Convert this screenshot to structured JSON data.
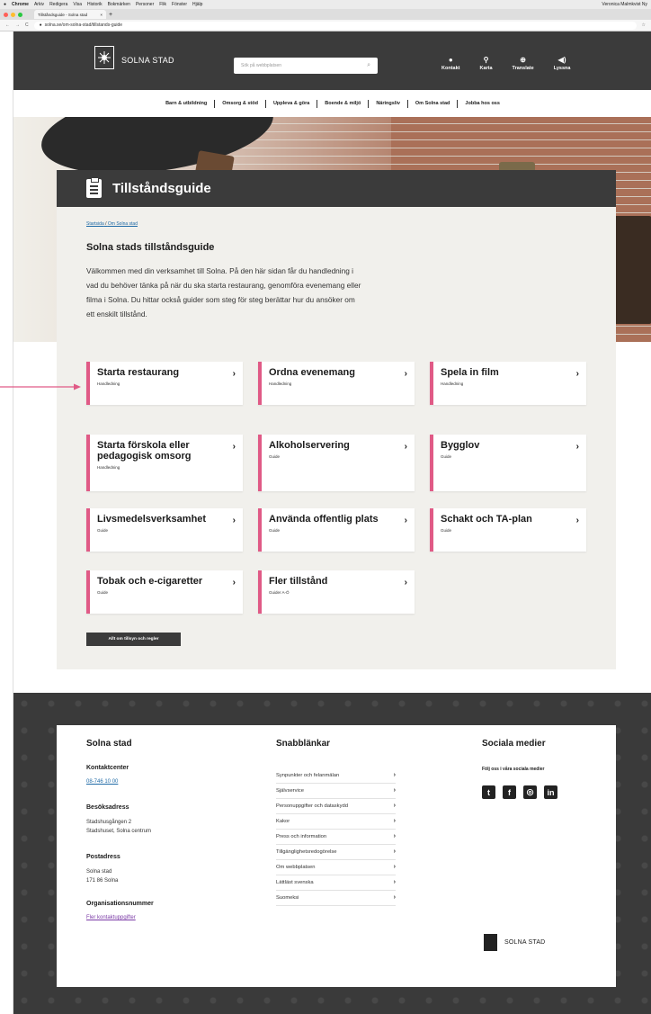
{
  "menubar": {
    "app": "Chrome",
    "items": [
      "Arkiv",
      "Redigera",
      "Visa",
      "Historik",
      "Bokmärken",
      "Personer",
      "Flik",
      "Fönster",
      "Hjälp"
    ],
    "right": "Veronica Malmkvist Ny"
  },
  "browser": {
    "tab_title": "Tillståndsguide - Solna stad",
    "url": "solna.se/om-solna-stad/tillstands-guide",
    "url_domain": "solna.se"
  },
  "header": {
    "logo_text": "SOLNA STAD",
    "search_placeholder": "Sök på webbplatsen",
    "icons": [
      {
        "label": "Kontakt",
        "icon": "chat-icon"
      },
      {
        "label": "Karta",
        "icon": "map-pin-icon"
      },
      {
        "label": "Translate",
        "icon": "globe-icon"
      },
      {
        "label": "Lyssna",
        "icon": "speaker-icon"
      }
    ]
  },
  "nav": [
    "Barn & utbildning",
    "Omsorg & stöd",
    "Uppleva & göra",
    "Boende & miljö",
    "Näringsliv",
    "Om Solna stad",
    "Jobba hos oss"
  ],
  "page": {
    "title": "Tillståndsguide",
    "breadcrumb": [
      "Startsida",
      "Om Solna stad"
    ],
    "heading": "Solna stads tillståndsguide",
    "intro": "Välkommen med din verksamhet till Solna. På den här sidan får du handledning i vad du behöver tänka på när du ska starta restaurang, genomföra evenemang eller filma i Solna. Du hittar också guider som steg för steg berättar hur du ansöker om ett enskilt tillstånd.",
    "all_button": "Allt om tillsyn och regler"
  },
  "tiles": [
    {
      "title": "Starta restaurang",
      "sub": "Handledning"
    },
    {
      "title": "Ordna evenemang",
      "sub": "Handledning"
    },
    {
      "title": "Spela in film",
      "sub": "Handledning"
    },
    {
      "title": "Starta förskola eller pedagogisk omsorg",
      "sub": "Handledning"
    },
    {
      "title": "Alkoholservering",
      "sub": "Guide"
    },
    {
      "title": "Bygglov",
      "sub": "Guide"
    },
    {
      "title": "Livsmedelsverksamhet",
      "sub": "Guide"
    },
    {
      "title": "Använda offentlig plats",
      "sub": "Guide"
    },
    {
      "title": "Schakt och TA-plan",
      "sub": "Guide"
    },
    {
      "title": "Tobak och e-cigaretter",
      "sub": "Guide"
    },
    {
      "title": "Fler tillstånd",
      "sub": "Guider A-Ö"
    }
  ],
  "footer": {
    "org": "Solna stad",
    "contact_label": "Kontaktcenter",
    "phone": "08-746 10 00",
    "visit_label": "Besöksadress",
    "visit": [
      "Stadshusgången 2",
      "Stadshuset, Solna centrum"
    ],
    "post_label": "Postadress",
    "post": [
      "Solna stad",
      "171 86 Solna"
    ],
    "orgnr_label": "Organisationsnummer",
    "more_link": "Fler kontaktuppgifter",
    "quick_title": "Snabblänkar",
    "quick": [
      "Synpunkter och felanmälan",
      "Självservice",
      "Personuppgifter och dataskydd",
      "Kakor",
      "Press och information",
      "Tillgänglighetsredogörelse",
      "Om webbplatsen",
      "Lättläst svenska",
      "Suomeksi"
    ],
    "social_title": "Sociala medier",
    "social_sub": "Följ oss i våra sociala medier",
    "social_icons": [
      "twitter-icon",
      "facebook-icon",
      "instagram-icon",
      "linkedin-icon"
    ],
    "logo_text": "SOLNA STAD"
  },
  "colors": {
    "accent": "#e05a86",
    "dark": "#3b3b3b",
    "card_bg": "#f1f0ec",
    "link": "#1f6aa6"
  }
}
